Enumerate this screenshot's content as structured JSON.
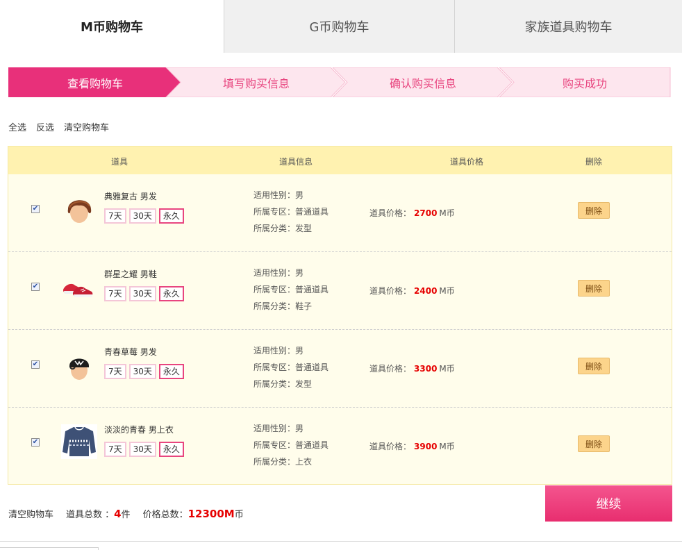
{
  "tabs": [
    {
      "label": "M币购物车"
    },
    {
      "label": "G币购物车"
    },
    {
      "label": "家族道具购物车"
    }
  ],
  "steps": [
    {
      "label": "查看购物车"
    },
    {
      "label": "填写购买信息"
    },
    {
      "label": "确认购买信息"
    },
    {
      "label": "购买成功"
    }
  ],
  "actions": {
    "select_all": "全选",
    "invert": "反选",
    "clear": "清空购物车"
  },
  "table": {
    "headers": {
      "item": "道具",
      "info": "道具信息",
      "price": "道具价格",
      "delete": "删除"
    },
    "rows": [
      {
        "checked": true,
        "name": "典雅复古 男发",
        "durations": [
          "7天",
          "30天",
          "永久"
        ],
        "selected_duration": "永久",
        "gender": "适用性别：男",
        "zone": "所属专区：普通道具",
        "category": "所属分类：发型",
        "price_label": "道具价格：",
        "price_value": "2700",
        "price_unit": "M币",
        "delete_label": "删除",
        "icon": "hair-icon"
      },
      {
        "checked": true,
        "name": "群星之耀 男鞋",
        "durations": [
          "7天",
          "30天",
          "永久"
        ],
        "selected_duration": "永久",
        "gender": "适用性别：男",
        "zone": "所属专区：普通道具",
        "category": "所属分类：鞋子",
        "price_label": "道具价格：",
        "price_value": "2400",
        "price_unit": "M币",
        "delete_label": "删除",
        "icon": "shoes-icon"
      },
      {
        "checked": true,
        "name": "青春草莓 男发",
        "durations": [
          "7天",
          "30天",
          "永久"
        ],
        "selected_duration": "永久",
        "gender": "适用性别：男",
        "zone": "所属专区：普通道具",
        "category": "所属分类：发型",
        "price_label": "道具价格：",
        "price_value": "3300",
        "price_unit": "M币",
        "delete_label": "删除",
        "icon": "cap-hair-icon"
      },
      {
        "checked": true,
        "name": "淡淡的青春 男上衣",
        "durations": [
          "7天",
          "30天",
          "永久"
        ],
        "selected_duration": "永久",
        "gender": "适用性别：男",
        "zone": "所属专区：普通道具",
        "category": "所属分类：上衣",
        "price_label": "道具价格：",
        "price_value": "3900",
        "price_unit": "M币",
        "delete_label": "删除",
        "icon": "sweater-icon"
      }
    ]
  },
  "footer": {
    "clear": "清空购物车",
    "count_label": "道具总数 ：",
    "count_value": "4",
    "count_unit": "件",
    "total_label": "价格总数：",
    "total_value": "12300M",
    "total_unit": "币",
    "continue_label": "继续"
  },
  "colors": {
    "accent": "#e82e6f",
    "step_inactive": "#fde6ee",
    "table_head": "#fff2b0",
    "table_body": "#fffdeb",
    "price": "#e60000"
  }
}
